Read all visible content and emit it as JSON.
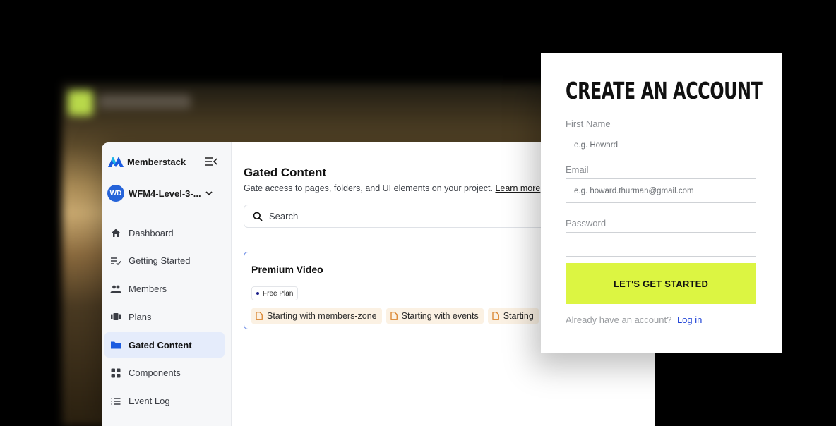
{
  "sidebar": {
    "brand": "Memberstack",
    "workspace": {
      "initials": "WD",
      "name": "WFM4-Level-3-..."
    },
    "items": [
      {
        "label": "Dashboard",
        "icon": "home-icon",
        "active": false
      },
      {
        "label": "Getting Started",
        "icon": "checklist-icon",
        "active": false
      },
      {
        "label": "Members",
        "icon": "people-icon",
        "active": false
      },
      {
        "label": "Plans",
        "icon": "plans-icon",
        "active": false
      },
      {
        "label": "Gated Content",
        "icon": "folder-icon",
        "active": true
      },
      {
        "label": "Components",
        "icon": "grid-icon",
        "active": false
      },
      {
        "label": "Event Log",
        "icon": "list-icon",
        "active": false
      }
    ]
  },
  "main": {
    "title": "Gated Content",
    "subtitle": "Gate access to pages, folders, and UI elements on your project.",
    "learn_more": "Learn more",
    "search_placeholder": "Search",
    "card": {
      "title": "Premium Video",
      "plan": "Free Plan",
      "tags": [
        "Starting with members-zone",
        "Starting with events",
        "Starting"
      ]
    }
  },
  "form": {
    "title": "CREATE AN ACCOUNT",
    "first_name_label": "First Name",
    "first_name_placeholder": "e.g. Howard",
    "email_label": "Email",
    "email_placeholder": "e.g. howard.thurman@gmail.com",
    "password_label": "Password",
    "password_value": "",
    "submit": "LET'S GET STARTED",
    "login_prompt": "Already have an account?",
    "login_link": "Log in"
  },
  "colors": {
    "accent": "#dcf542",
    "brand_blue": "#2563d9",
    "active_nav": "#e5ecfb",
    "link": "#1a3fd6"
  }
}
